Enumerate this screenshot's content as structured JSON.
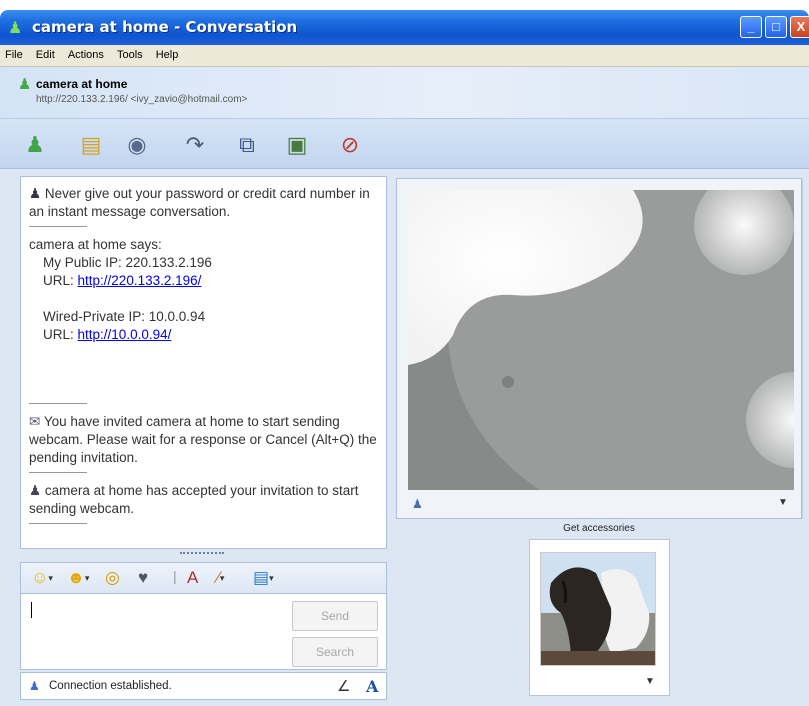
{
  "window": {
    "title": "camera at home - Conversation",
    "buttons": {
      "minimize": "_",
      "maximize": "□",
      "close": "X"
    }
  },
  "menu": [
    "File",
    "Edit",
    "Actions",
    "Tools",
    "Help"
  ],
  "contact": {
    "name": "camera at home",
    "address": "http://220.133.2.196/ <ivy_zavio@hotmail.com>"
  },
  "toolbar": {
    "icons": [
      "invite-contact-icon",
      "send-files-icon",
      "webcam-icon",
      "call-icon",
      "activities-icon",
      "games-icon",
      "block-icon"
    ]
  },
  "history": {
    "warning": "Never give out your password or credit card number in an instant message conversation.",
    "says": "camera at home says:",
    "public_ip_label": "My Public IP: 220.133.2.196",
    "url_label": "URL:",
    "public_url": "http://220.133.2.196/",
    "private_ip_label": "Wired-Private IP: 10.0.0.94",
    "private_url": "http://10.0.0.94/",
    "invite_msg": "You have invited camera at home to start sending webcam. Please wait for a response or Cancel (Alt+Q) the pending invitation.",
    "accepted_msg": "camera at home has accepted your invitation to start sending webcam."
  },
  "compose": {
    "send": "Send",
    "search": "Search"
  },
  "status": {
    "text": "Connection established."
  },
  "accessories": {
    "label": "Get accessories"
  },
  "colors": {
    "titlebar": "#1f6fe0",
    "panel_bg": "#dde7f4",
    "link": "#0000ee"
  }
}
